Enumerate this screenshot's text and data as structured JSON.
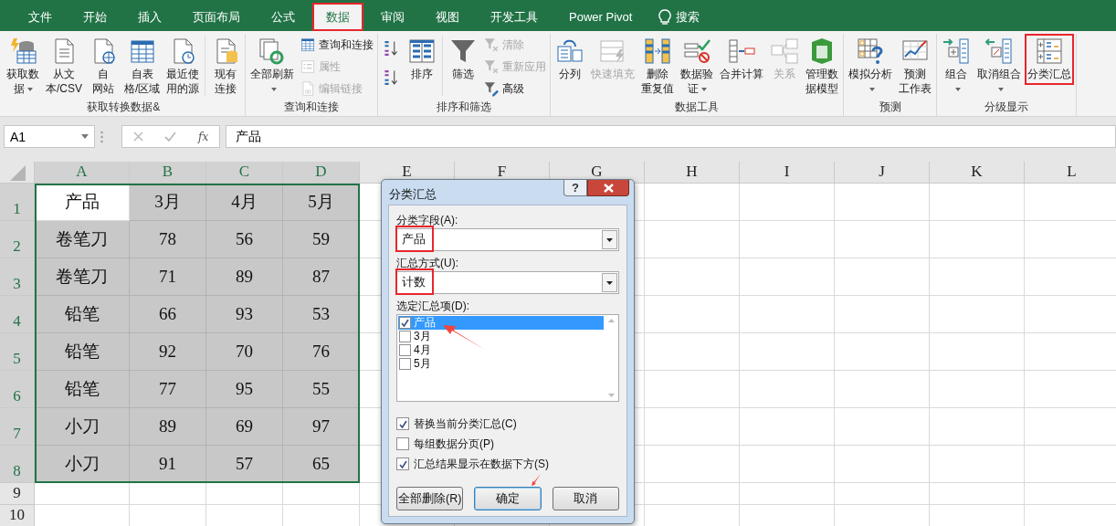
{
  "tabs": [
    {
      "label": "文件",
      "selected": false,
      "highlighted": false
    },
    {
      "label": "开始",
      "selected": false,
      "highlighted": false
    },
    {
      "label": "插入",
      "selected": false,
      "highlighted": false
    },
    {
      "label": "页面布局",
      "selected": false,
      "highlighted": false
    },
    {
      "label": "公式",
      "selected": false,
      "highlighted": false
    },
    {
      "label": "数据",
      "selected": true,
      "highlighted": true
    },
    {
      "label": "审阅",
      "selected": false,
      "highlighted": false
    },
    {
      "label": "视图",
      "selected": false,
      "highlighted": false
    },
    {
      "label": "开发工具",
      "selected": false,
      "highlighted": false
    },
    {
      "label": "Power Pivot",
      "selected": false,
      "highlighted": false
    }
  ],
  "search": {
    "label": "搜索"
  },
  "ribbon": {
    "groups": [
      {
        "label": "获取转换数据&",
        "items": [
          {
            "kind": "large",
            "lines": [
              "获取数",
              "据"
            ],
            "dropdown": true,
            "disabled": false
          },
          {
            "kind": "large",
            "lines": [
              "从文",
              "本/CSV"
            ],
            "disabled": false
          },
          {
            "kind": "large",
            "lines": [
              "自",
              "网站"
            ],
            "disabled": false
          },
          {
            "kind": "large",
            "lines": [
              "自表",
              "格/区域"
            ],
            "disabled": false
          },
          {
            "kind": "large",
            "lines": [
              "最近使",
              "用的源"
            ],
            "disabled": false
          },
          {
            "kind": "separator"
          },
          {
            "kind": "large",
            "lines": [
              "现有",
              "连接"
            ],
            "disabled": false
          }
        ]
      },
      {
        "label": "查询和连接",
        "items": [
          {
            "kind": "large",
            "lines": [
              "全部刷新"
            ],
            "dropdown": true,
            "disabled": false
          },
          {
            "kind": "stack",
            "buttons": [
              {
                "label": "查询和连接",
                "disabled": false
              },
              {
                "label": "属性",
                "disabled": true
              },
              {
                "label": "编辑链接",
                "disabled": true
              }
            ]
          }
        ]
      },
      {
        "label": "排序和筛选",
        "items": [
          {
            "kind": "stack",
            "buttons": [
              {
                "disabled": false
              },
              {
                "disabled": false
              }
            ]
          },
          {
            "kind": "large",
            "lines": [
              "排序"
            ],
            "disabled": false
          },
          {
            "kind": "separator"
          },
          {
            "kind": "large",
            "lines": [
              "筛选"
            ],
            "disabled": false
          },
          {
            "kind": "stack",
            "buttons": [
              {
                "label": "清除",
                "disabled": true
              },
              {
                "label": "重新应用",
                "disabled": true
              },
              {
                "label": "高级",
                "disabled": false
              }
            ]
          }
        ]
      },
      {
        "label": "数据工具",
        "items": [
          {
            "kind": "large",
            "lines": [
              "分列"
            ],
            "disabled": false
          },
          {
            "kind": "large",
            "lines": [
              "快速填充"
            ],
            "disabled": true
          },
          {
            "kind": "large",
            "lines": [
              "删除",
              "重复值"
            ],
            "disabled": false
          },
          {
            "kind": "large",
            "lines": [
              "数据验",
              "证"
            ],
            "dropdown": true,
            "disabled": false
          },
          {
            "kind": "large",
            "lines": [
              "合并计算"
            ],
            "disabled": false
          },
          {
            "kind": "large",
            "lines": [
              "关系"
            ],
            "disabled": true
          },
          {
            "kind": "large",
            "lines": [
              "管理数",
              "据模型"
            ],
            "disabled": false
          }
        ]
      },
      {
        "label": "预测",
        "items": [
          {
            "kind": "large",
            "lines": [
              "模拟分析"
            ],
            "dropdown": true,
            "disabled": false
          },
          {
            "kind": "large",
            "lines": [
              "预测",
              "工作表"
            ],
            "disabled": false
          }
        ]
      },
      {
        "label": "分级显示",
        "items": [
          {
            "kind": "large",
            "lines": [
              "组合"
            ],
            "dropdown": true,
            "disabled": false
          },
          {
            "kind": "large",
            "lines": [
              "取消组合"
            ],
            "dropdown": true,
            "disabled": false
          },
          {
            "kind": "large",
            "lines": [
              "分类汇总"
            ],
            "disabled": false,
            "highlighted": true
          }
        ]
      }
    ]
  },
  "formula_bar": {
    "name_box": "A1",
    "fx": "fx",
    "formula": "产品"
  },
  "sheet": {
    "columns": [
      {
        "label": "A",
        "selected": true
      },
      {
        "label": "B",
        "selected": true
      },
      {
        "label": "C",
        "selected": true
      },
      {
        "label": "D",
        "selected": true
      },
      {
        "label": "E",
        "selected": false
      },
      {
        "label": "F",
        "selected": false
      },
      {
        "label": "G",
        "selected": false
      },
      {
        "label": "H",
        "selected": false
      },
      {
        "label": "I",
        "selected": false
      },
      {
        "label": "J",
        "selected": false
      },
      {
        "label": "K",
        "selected": false
      },
      {
        "label": "L",
        "selected": false
      }
    ],
    "rows": [
      {
        "header": "1",
        "selected": true,
        "cells": [
          {
            "text": "产品",
            "shaded": false
          },
          {
            "text": "3月",
            "shaded": true
          },
          {
            "text": "4月",
            "shaded": true
          },
          {
            "text": "5月",
            "shaded": true
          }
        ]
      },
      {
        "header": "2",
        "selected": true,
        "cells": [
          {
            "text": "卷笔刀",
            "shaded": true
          },
          {
            "text": "78",
            "shaded": true
          },
          {
            "text": "56",
            "shaded": true
          },
          {
            "text": "59",
            "shaded": true
          }
        ]
      },
      {
        "header": "3",
        "selected": true,
        "cells": [
          {
            "text": "卷笔刀",
            "shaded": true
          },
          {
            "text": "71",
            "shaded": true
          },
          {
            "text": "89",
            "shaded": true
          },
          {
            "text": "87",
            "shaded": true
          }
        ]
      },
      {
        "header": "4",
        "selected": true,
        "cells": [
          {
            "text": "铅笔",
            "shaded": true
          },
          {
            "text": "66",
            "shaded": true
          },
          {
            "text": "93",
            "shaded": true
          },
          {
            "text": "53",
            "shaded": true
          }
        ]
      },
      {
        "header": "5",
        "selected": true,
        "cells": [
          {
            "text": "铅笔",
            "shaded": true
          },
          {
            "text": "92",
            "shaded": true
          },
          {
            "text": "70",
            "shaded": true
          },
          {
            "text": "76",
            "shaded": true
          }
        ]
      },
      {
        "header": "6",
        "selected": true,
        "cells": [
          {
            "text": "铅笔",
            "shaded": true
          },
          {
            "text": "77",
            "shaded": true
          },
          {
            "text": "95",
            "shaded": true
          },
          {
            "text": "55",
            "shaded": true
          }
        ]
      },
      {
        "header": "7",
        "selected": true,
        "cells": [
          {
            "text": "小刀",
            "shaded": true
          },
          {
            "text": "89",
            "shaded": true
          },
          {
            "text": "69",
            "shaded": true
          },
          {
            "text": "97",
            "shaded": true
          }
        ]
      },
      {
        "header": "8",
        "selected": true,
        "cells": [
          {
            "text": "小刀",
            "shaded": true
          },
          {
            "text": "91",
            "shaded": true
          },
          {
            "text": "57",
            "shaded": true
          },
          {
            "text": "65",
            "shaded": true
          }
        ]
      },
      {
        "header": "9",
        "selected": false,
        "cells": []
      },
      {
        "header": "10",
        "selected": false,
        "cells": []
      }
    ]
  },
  "dialog": {
    "title": "分类汇总",
    "help": "?",
    "fields": [
      {
        "label": "分类字段(A):",
        "value": "产品",
        "highlighted": true
      },
      {
        "label": "汇总方式(U):",
        "value": "计数",
        "highlighted": true
      }
    ],
    "list_label": "选定汇总项(D):",
    "list": [
      {
        "label": "产品",
        "checked": true,
        "selected": true,
        "pointed": true
      },
      {
        "label": "3月",
        "checked": false,
        "selected": false
      },
      {
        "label": "4月",
        "checked": false,
        "selected": false
      },
      {
        "label": "5月",
        "checked": false,
        "selected": false
      }
    ],
    "options": [
      {
        "label": "替换当前分类汇总(C)",
        "checked": true
      },
      {
        "label": "每组数据分页(P)",
        "checked": false
      },
      {
        "label": "汇总结果显示在数据下方(S)",
        "checked": true
      }
    ],
    "buttons": [
      {
        "label": "全部删除(R)",
        "default": false
      },
      {
        "label": "确定",
        "default": true,
        "pointed": true
      },
      {
        "label": "取消",
        "default": false
      }
    ]
  }
}
